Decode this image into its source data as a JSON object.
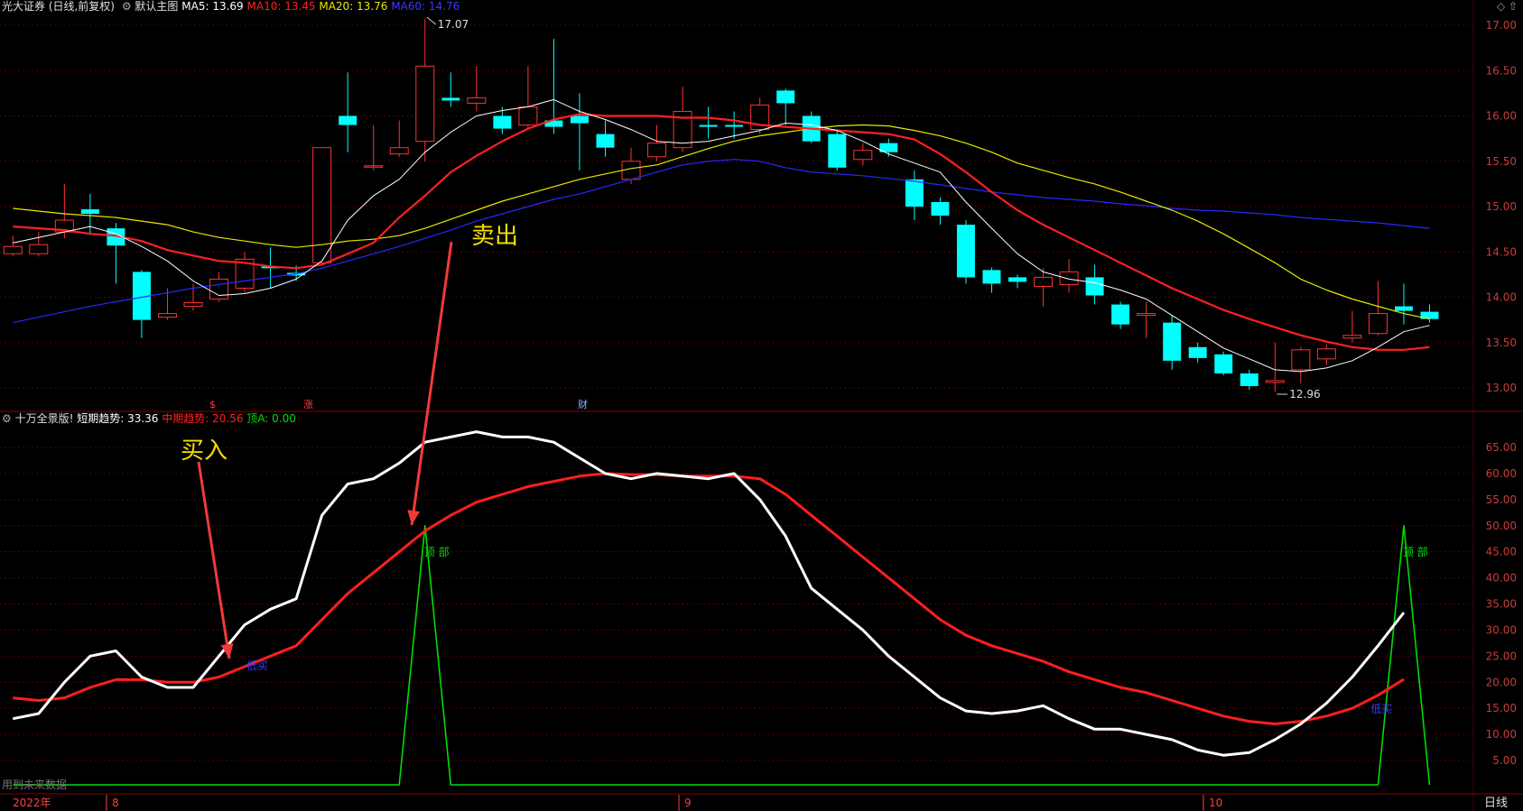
{
  "header": {
    "stock_title": "光大证券 (日线,前复权)",
    "main_chart_name": "默认主图",
    "ma_labels": [
      {
        "text": "MA5: 13.69",
        "color": "#ffffff"
      },
      {
        "text": "MA10: 13.45",
        "color": "#ff2020"
      },
      {
        "text": "MA20: 13.76",
        "color": "#e8e800"
      },
      {
        "text": "MA60: 14.76",
        "color": "#3a3aff"
      }
    ]
  },
  "sub_header": {
    "indicator_name": "十万全景版!",
    "items": [
      {
        "text": "短期趋势: 33.36",
        "color": "#ffffff"
      },
      {
        "text": "中期趋势: 20.56",
        "color": "#ff2020"
      },
      {
        "text": "顶A: 0.00",
        "color": "#00dd00"
      }
    ]
  },
  "annotations": {
    "sell": "卖出",
    "buy": "买入",
    "top_marker": "顶 部",
    "buy_marker": "低买",
    "high_label": "17.07",
    "low_label": "12.96",
    "event_markers": [
      "$",
      "涨",
      "财"
    ]
  },
  "bottom_bar": {
    "dates": [
      "2022年",
      "8",
      "9",
      "10"
    ],
    "period": "日线",
    "left_text": "用到未来数据"
  },
  "colors": {
    "up": "#ff3232",
    "down": "#00ffff",
    "ma5": "#ffffff",
    "ma10": "#ff2020",
    "ma20": "#e8e800",
    "ma60": "#2828ff",
    "grid": "#5a0000",
    "axis_text": "#c83c3c"
  },
  "chart_data": [
    {
      "type": "candlestick",
      "title": "默认主图",
      "ylim": [
        12.9,
        17.1
      ],
      "y_ticks": [
        "17.00",
        "16.50",
        "16.00",
        "15.50",
        "15.00",
        "14.50",
        "14.00",
        "13.50",
        "13.00"
      ],
      "candles": [
        {
          "o": 14.48,
          "c": 14.56,
          "h": 14.68,
          "l": 14.45
        },
        {
          "o": 14.48,
          "c": 14.58,
          "h": 14.72,
          "l": 14.45
        },
        {
          "o": 14.72,
          "c": 14.85,
          "h": 15.25,
          "l": 14.65
        },
        {
          "o": 14.97,
          "c": 14.92,
          "h": 15.14,
          "l": 14.7
        },
        {
          "o": 14.76,
          "c": 14.57,
          "h": 14.82,
          "l": 14.15
        },
        {
          "o": 14.28,
          "c": 13.75,
          "h": 14.3,
          "l": 13.55
        },
        {
          "o": 13.78,
          "c": 13.82,
          "h": 14.1,
          "l": 13.75
        },
        {
          "o": 13.9,
          "c": 13.94,
          "h": 14.15,
          "l": 13.85
        },
        {
          "o": 13.98,
          "c": 14.2,
          "h": 14.28,
          "l": 13.95
        },
        {
          "o": 14.1,
          "c": 14.42,
          "h": 14.5,
          "l": 14.05
        },
        {
          "o": 14.34,
          "c": 14.32,
          "h": 14.55,
          "l": 14.1
        },
        {
          "o": 14.27,
          "c": 14.24,
          "h": 14.35,
          "l": 14.18
        },
        {
          "o": 14.38,
          "c": 15.65,
          "h": 15.65,
          "l": 14.35
        },
        {
          "o": 16.0,
          "c": 15.9,
          "h": 16.48,
          "l": 15.6
        },
        {
          "o": 15.45,
          "c": 15.45,
          "h": 15.9,
          "l": 15.4
        },
        {
          "o": 15.58,
          "c": 15.65,
          "h": 15.95,
          "l": 15.55
        },
        {
          "o": 15.72,
          "c": 16.55,
          "h": 17.07,
          "l": 15.5
        },
        {
          "o": 16.2,
          "c": 16.17,
          "h": 16.48,
          "l": 16.1
        },
        {
          "o": 16.14,
          "c": 16.2,
          "h": 16.55,
          "l": 16.05
        },
        {
          "o": 16.0,
          "c": 15.86,
          "h": 16.1,
          "l": 15.8
        },
        {
          "o": 15.9,
          "c": 16.1,
          "h": 16.55,
          "l": 15.85
        },
        {
          "o": 15.95,
          "c": 15.88,
          "h": 16.85,
          "l": 15.8
        },
        {
          "o": 16.0,
          "c": 15.92,
          "h": 16.25,
          "l": 15.4
        },
        {
          "o": 15.8,
          "c": 15.65,
          "h": 15.95,
          "l": 15.55
        },
        {
          "o": 15.3,
          "c": 15.5,
          "h": 15.65,
          "l": 15.25
        },
        {
          "o": 15.55,
          "c": 15.7,
          "h": 15.9,
          "l": 15.5
        },
        {
          "o": 15.65,
          "c": 16.05,
          "h": 16.32,
          "l": 15.6
        },
        {
          "o": 15.9,
          "c": 15.88,
          "h": 16.1,
          "l": 15.75
        },
        {
          "o": 15.9,
          "c": 15.88,
          "h": 16.05,
          "l": 15.75
        },
        {
          "o": 15.85,
          "c": 16.12,
          "h": 16.2,
          "l": 15.8
        },
        {
          "o": 16.28,
          "c": 16.14,
          "h": 16.3,
          "l": 15.9
        },
        {
          "o": 16.0,
          "c": 15.72,
          "h": 16.05,
          "l": 15.7
        },
        {
          "o": 15.8,
          "c": 15.43,
          "h": 15.85,
          "l": 15.4
        },
        {
          "o": 15.52,
          "c": 15.62,
          "h": 15.7,
          "l": 15.45
        },
        {
          "o": 15.7,
          "c": 15.6,
          "h": 15.75,
          "l": 15.55
        },
        {
          "o": 15.3,
          "c": 15.0,
          "h": 15.4,
          "l": 14.85
        },
        {
          "o": 15.05,
          "c": 14.9,
          "h": 15.1,
          "l": 14.8
        },
        {
          "o": 14.8,
          "c": 14.22,
          "h": 14.85,
          "l": 14.15
        },
        {
          "o": 14.3,
          "c": 14.15,
          "h": 14.33,
          "l": 14.05
        },
        {
          "o": 14.22,
          "c": 14.17,
          "h": 14.25,
          "l": 14.1
        },
        {
          "o": 14.12,
          "c": 14.22,
          "h": 14.32,
          "l": 13.9
        },
        {
          "o": 14.14,
          "c": 14.28,
          "h": 14.42,
          "l": 14.05
        },
        {
          "o": 14.22,
          "c": 14.02,
          "h": 14.36,
          "l": 13.92
        },
        {
          "o": 13.92,
          "c": 13.7,
          "h": 13.95,
          "l": 13.65
        },
        {
          "o": 13.8,
          "c": 13.82,
          "h": 13.95,
          "l": 13.55
        },
        {
          "o": 13.72,
          "c": 13.3,
          "h": 13.8,
          "l": 13.2
        },
        {
          "o": 13.45,
          "c": 13.33,
          "h": 13.5,
          "l": 13.28
        },
        {
          "o": 13.37,
          "c": 13.16,
          "h": 13.4,
          "l": 13.14
        },
        {
          "o": 13.16,
          "c": 13.02,
          "h": 13.2,
          "l": 12.98
        },
        {
          "o": 13.06,
          "c": 13.08,
          "h": 13.5,
          "l": 12.96
        },
        {
          "o": 13.2,
          "c": 13.42,
          "h": 13.45,
          "l": 13.05
        },
        {
          "o": 13.32,
          "c": 13.43,
          "h": 13.48,
          "l": 13.25
        },
        {
          "o": 13.55,
          "c": 13.58,
          "h": 13.85,
          "l": 13.5
        },
        {
          "o": 13.6,
          "c": 13.82,
          "h": 14.18,
          "l": 13.58
        },
        {
          "o": 13.9,
          "c": 13.85,
          "h": 14.15,
          "l": 13.7
        },
        {
          "o": 13.84,
          "c": 13.76,
          "h": 13.92,
          "l": 13.72
        }
      ],
      "ma5": [
        14.6,
        14.66,
        14.72,
        14.78,
        14.7,
        14.56,
        14.4,
        14.18,
        14.02,
        14.04,
        14.1,
        14.2,
        14.4,
        14.85,
        15.12,
        15.3,
        15.6,
        15.82,
        16.0,
        16.06,
        16.1,
        16.18,
        16.05,
        15.96,
        15.85,
        15.72,
        15.7,
        15.72,
        15.78,
        15.84,
        15.92,
        15.9,
        15.84,
        15.72,
        15.58,
        15.48,
        15.38,
        15.05,
        14.76,
        14.48,
        14.28,
        14.2,
        14.16,
        14.08,
        13.98,
        13.8,
        13.62,
        13.44,
        13.32,
        13.2,
        13.18,
        13.22,
        13.3,
        13.45,
        13.62,
        13.69
      ],
      "ma10": [
        14.78,
        14.76,
        14.74,
        14.7,
        14.68,
        14.62,
        14.52,
        14.46,
        14.4,
        14.38,
        14.34,
        14.32,
        14.36,
        14.48,
        14.6,
        14.88,
        15.12,
        15.38,
        15.56,
        15.72,
        15.86,
        15.96,
        16.02,
        16.0,
        16.0,
        16.0,
        15.98,
        15.98,
        15.95,
        15.9,
        15.88,
        15.86,
        15.84,
        15.82,
        15.8,
        15.74,
        15.58,
        15.38,
        15.16,
        14.96,
        14.8,
        14.66,
        14.52,
        14.38,
        14.24,
        14.1,
        13.98,
        13.86,
        13.76,
        13.67,
        13.58,
        13.51,
        13.45,
        13.42,
        13.42,
        13.45
      ],
      "ma20": [
        14.98,
        14.95,
        14.92,
        14.9,
        14.88,
        14.84,
        14.8,
        14.72,
        14.66,
        14.62,
        14.58,
        14.55,
        14.58,
        14.62,
        14.64,
        14.68,
        14.76,
        14.86,
        14.96,
        15.06,
        15.14,
        15.22,
        15.3,
        15.36,
        15.42,
        15.46,
        15.55,
        15.64,
        15.72,
        15.78,
        15.82,
        15.86,
        15.89,
        15.9,
        15.89,
        15.84,
        15.78,
        15.7,
        15.6,
        15.48,
        15.4,
        15.32,
        15.25,
        15.16,
        15.06,
        14.96,
        14.84,
        14.7,
        14.54,
        14.38,
        14.2,
        14.08,
        13.98,
        13.9,
        13.82,
        13.76
      ],
      "ma60": [
        13.72,
        13.78,
        13.84,
        13.9,
        13.95,
        14.0,
        14.05,
        14.1,
        14.14,
        14.18,
        14.22,
        14.26,
        14.32,
        14.4,
        14.48,
        14.56,
        14.65,
        14.74,
        14.84,
        14.92,
        15.0,
        15.08,
        15.14,
        15.22,
        15.3,
        15.38,
        15.46,
        15.5,
        15.52,
        15.5,
        15.43,
        15.38,
        15.36,
        15.34,
        15.31,
        15.28,
        15.24,
        15.2,
        15.16,
        15.13,
        15.1,
        15.08,
        15.06,
        15.03,
        15.01,
        14.98,
        14.96,
        14.95,
        14.93,
        14.91,
        14.88,
        14.86,
        14.84,
        14.82,
        14.79,
        14.76
      ]
    },
    {
      "type": "line",
      "title": "十万全景版!",
      "ylim": [
        0,
        70
      ],
      "y_ticks": [
        "65.00",
        "60.00",
        "55.00",
        "50.00",
        "45.00",
        "40.00",
        "35.00",
        "30.00",
        "25.00",
        "20.00",
        "15.00",
        "10.00",
        "5.00"
      ],
      "series": [
        {
          "name": "短期趋势",
          "values": [
            13,
            14,
            20,
            25,
            26,
            21,
            19,
            19,
            25,
            31,
            34,
            36,
            52,
            58,
            59,
            62,
            66,
            67,
            68,
            67,
            67,
            66,
            63,
            60,
            59,
            60,
            59.5,
            59,
            60,
            55,
            48,
            38,
            34,
            30,
            25,
            21,
            17,
            14.5,
            14,
            14.5,
            15.5,
            13,
            11,
            11,
            10,
            9,
            7,
            6,
            6.5,
            9,
            12,
            16,
            21,
            27,
            33.36
          ]
        },
        {
          "name": "中期趋势",
          "values": [
            17,
            16.5,
            17,
            19,
            20.5,
            20.5,
            20,
            20,
            21,
            23,
            25,
            27,
            32,
            37,
            41,
            45,
            49,
            52,
            54.5,
            56,
            57.5,
            58.5,
            59.5,
            60,
            59.8,
            59.8,
            59.5,
            59.5,
            59.5,
            59,
            56,
            52,
            48,
            44,
            40,
            36,
            32,
            29,
            27,
            25.5,
            24,
            22,
            20.5,
            19,
            18,
            16.5,
            15,
            13.5,
            12.5,
            12,
            12.5,
            13.5,
            15,
            17.5,
            20.56
          ]
        },
        {
          "name": "顶A",
          "values": [
            0,
            0,
            0,
            0,
            0,
            0,
            0,
            0,
            0,
            0,
            0,
            0,
            0,
            0,
            0,
            0,
            50,
            0,
            0,
            0,
            0,
            0,
            0,
            0,
            0,
            0,
            0,
            0,
            0,
            0,
            0,
            0,
            0,
            0,
            0,
            0,
            0,
            0,
            0,
            0,
            0,
            0,
            0,
            0,
            0,
            0,
            0,
            0,
            0,
            0,
            0,
            0,
            0,
            0,
            50,
            0
          ]
        }
      ]
    }
  ]
}
